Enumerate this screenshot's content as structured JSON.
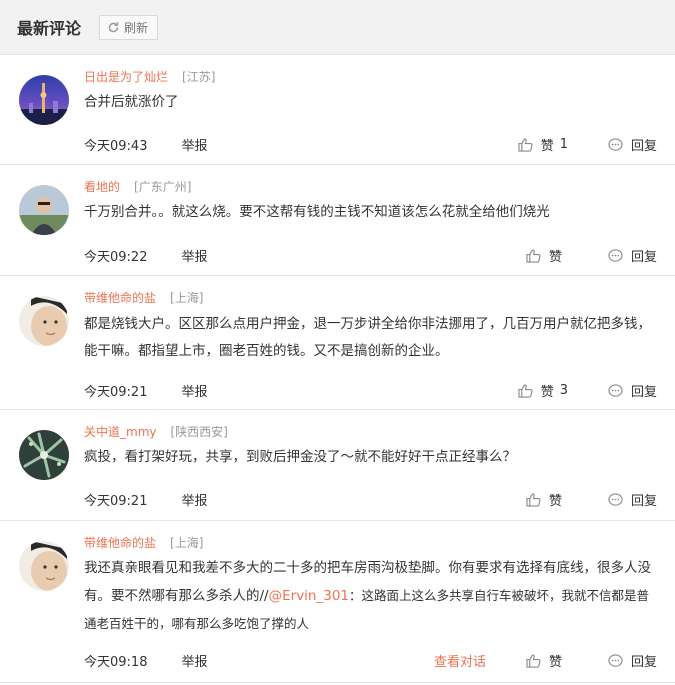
{
  "header": {
    "title": "最新评论",
    "refresh_label": "刷新"
  },
  "comments": [
    {
      "username": "日出是为了灿烂",
      "location": "[江苏]",
      "text": "合并后就涨价了",
      "time": "今天09:43",
      "report": "举报",
      "like_label": "赞",
      "like_count": "1",
      "reply": "回复"
    },
    {
      "username": "看地的",
      "location": "[广东广州]",
      "text": "千万别合并。。就这么烧。要不这帮有钱的主钱不知道该怎么花就全给他们烧光",
      "time": "今天09:22",
      "report": "举报",
      "like_label": "赞",
      "like_count": "",
      "reply": "回复"
    },
    {
      "username": "带维他命的盐",
      "location": "[上海]",
      "text": "都是烧钱大户。区区那么点用户押金，退一万步讲全给你非法挪用了，几百万用户就亿把多钱，能干嘛。都指望上市，圈老百姓的钱。又不是搞创新的企业。",
      "time": "今天09:21",
      "report": "举报",
      "like_label": "赞",
      "like_count": "3",
      "reply": "回复"
    },
    {
      "username": "关中道_mmy",
      "location": "[陕西西安]",
      "text": "疯投，看打架好玩，共享，到败后押金没了～就不能好好干点正经事么？",
      "time": "今天09:21",
      "report": "举报",
      "like_label": "赞",
      "like_count": "",
      "reply": "回复"
    },
    {
      "username": "带维他命的盐",
      "location": "[上海]",
      "text_a": "我还真亲眼看见和我差不多大的二十多的把车房雨沟极垫脚。你有要求有选择有底线，很多人没有。要不然哪有那么多杀人的//",
      "mention": "@Ervin_301",
      "text_b": "：这路面上这么多共享自行车被破坏，我就不信都是普通老百姓干的，哪有那么多吃饱了撑的人",
      "time": "今天09:18",
      "report": "举报",
      "see_conversation": "查看对话",
      "like_label": "赞",
      "like_count": "",
      "reply": "回复"
    }
  ]
}
